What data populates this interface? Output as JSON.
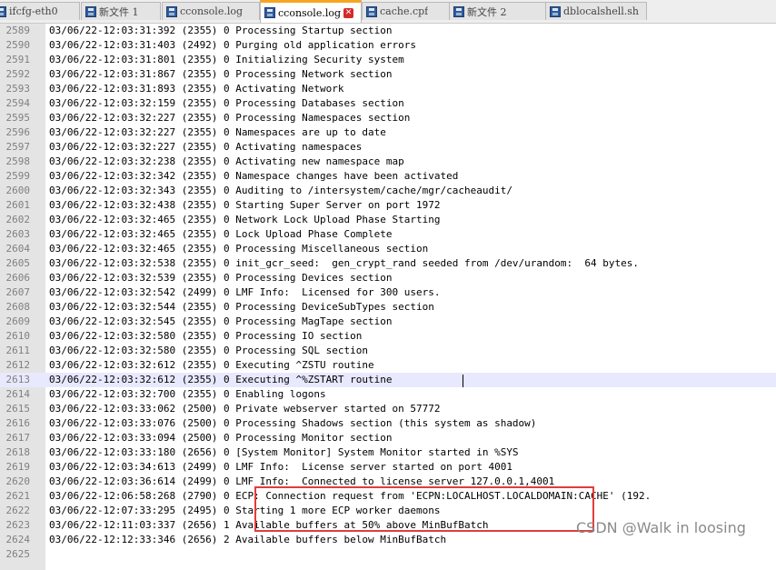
{
  "tabs": [
    {
      "label": "ifcfg-eth0",
      "icon": "save-disk-icon",
      "active": false
    },
    {
      "label": "新文件 1",
      "icon": "save-disk-icon",
      "active": false
    },
    {
      "label": "cconsole.log",
      "icon": "save-disk-icon",
      "active": false
    },
    {
      "label": "cconsole.log",
      "icon": "save-disk-icon",
      "active": true
    },
    {
      "label": "cache.cpf",
      "icon": "save-disk-icon",
      "active": false
    },
    {
      "label": "新文件 2",
      "icon": "save-disk-icon",
      "active": false
    },
    {
      "label": "dblocalshell.sh",
      "icon": "save-disk-icon",
      "active": false
    }
  ],
  "editor": {
    "current_line": 2613,
    "lines": [
      {
        "num": "2589",
        "text": "03/06/22-12:03:31:392 (2355) 0 Processing Startup section"
      },
      {
        "num": "2590",
        "text": "03/06/22-12:03:31:403 (2492) 0 Purging old application errors"
      },
      {
        "num": "2591",
        "text": "03/06/22-12:03:31:801 (2355) 0 Initializing Security system"
      },
      {
        "num": "2592",
        "text": "03/06/22-12:03:31:867 (2355) 0 Processing Network section"
      },
      {
        "num": "2593",
        "text": "03/06/22-12:03:31:893 (2355) 0 Activating Network"
      },
      {
        "num": "2594",
        "text": "03/06/22-12:03:32:159 (2355) 0 Processing Databases section"
      },
      {
        "num": "2595",
        "text": "03/06/22-12:03:32:227 (2355) 0 Processing Namespaces section"
      },
      {
        "num": "2596",
        "text": "03/06/22-12:03:32:227 (2355) 0 Namespaces are up to date"
      },
      {
        "num": "2597",
        "text": "03/06/22-12:03:32:227 (2355) 0 Activating namespaces"
      },
      {
        "num": "2598",
        "text": "03/06/22-12:03:32:238 (2355) 0 Activating new namespace map"
      },
      {
        "num": "2599",
        "text": "03/06/22-12:03:32:342 (2355) 0 Namespace changes have been activated"
      },
      {
        "num": "2600",
        "text": "03/06/22-12:03:32:343 (2355) 0 Auditing to /intersystem/cache/mgr/cacheaudit/"
      },
      {
        "num": "2601",
        "text": "03/06/22-12:03:32:438 (2355) 0 Starting Super Server on port 1972"
      },
      {
        "num": "2602",
        "text": "03/06/22-12:03:32:465 (2355) 0 Network Lock Upload Phase Starting"
      },
      {
        "num": "2603",
        "text": "03/06/22-12:03:32:465 (2355) 0 Lock Upload Phase Complete"
      },
      {
        "num": "2604",
        "text": "03/06/22-12:03:32:465 (2355) 0 Processing Miscellaneous section"
      },
      {
        "num": "2605",
        "text": "03/06/22-12:03:32:538 (2355) 0 init_gcr_seed:  gen_crypt_rand seeded from /dev/urandom:  64 bytes."
      },
      {
        "num": "2606",
        "text": "03/06/22-12:03:32:539 (2355) 0 Processing Devices section"
      },
      {
        "num": "2607",
        "text": "03/06/22-12:03:32:542 (2499) 0 LMF Info:  Licensed for 300 users."
      },
      {
        "num": "2608",
        "text": "03/06/22-12:03:32:544 (2355) 0 Processing DeviceSubTypes section"
      },
      {
        "num": "2609",
        "text": "03/06/22-12:03:32:545 (2355) 0 Processing MagTape section"
      },
      {
        "num": "2610",
        "text": "03/06/22-12:03:32:580 (2355) 0 Processing IO section"
      },
      {
        "num": "2611",
        "text": "03/06/22-12:03:32:580 (2355) 0 Processing SQL section"
      },
      {
        "num": "2612",
        "text": "03/06/22-12:03:32:612 (2355) 0 Executing ^ZSTU routine"
      },
      {
        "num": "2613",
        "text": "03/06/22-12:03:32:612 (2355) 0 Executing ^%ZSTART routine"
      },
      {
        "num": "2614",
        "text": "03/06/22-12:03:32:700 (2355) 0 Enabling logons"
      },
      {
        "num": "2615",
        "text": "03/06/22-12:03:33:062 (2500) 0 Private webserver started on 57772"
      },
      {
        "num": "2616",
        "text": "03/06/22-12:03:33:076 (2500) 0 Processing Shadows section (this system as shadow)"
      },
      {
        "num": "2617",
        "text": "03/06/22-12:03:33:094 (2500) 0 Processing Monitor section"
      },
      {
        "num": "2618",
        "text": "03/06/22-12:03:33:180 (2656) 0 [System Monitor] System Monitor started in %SYS"
      },
      {
        "num": "2619",
        "text": "03/06/22-12:03:34:613 (2499) 0 LMF Info:  License server started on port 4001"
      },
      {
        "num": "2620",
        "text": "03/06/22-12:03:36:614 (2499) 0 LMF Info:  Connected to license server 127.0.0.1,4001"
      },
      {
        "num": "2621",
        "text": "03/06/22-12:06:58:268 (2790) 0 ECP: Connection request from 'ECPN:LOCALHOST.LOCALDOMAIN:CACHE' (192."
      },
      {
        "num": "2622",
        "text": "03/06/22-12:07:33:295 (2495) 0 Starting 1 more ECP worker daemons"
      },
      {
        "num": "2623",
        "text": "03/06/22-12:11:03:337 (2656) 1 Available buffers at 50% above MinBufBatch"
      },
      {
        "num": "2624",
        "text": "03/06/22-12:12:33:346 (2656) 2 Available buffers below MinBufBatch"
      },
      {
        "num": "2625",
        "text": ""
      }
    ]
  },
  "watermark": "CSDN @Walk in loosing",
  "colors": {
    "highlight_box": "#e23c3c",
    "active_tab_accent": "#f7a521",
    "current_line_bg": "#e8e8ff"
  }
}
